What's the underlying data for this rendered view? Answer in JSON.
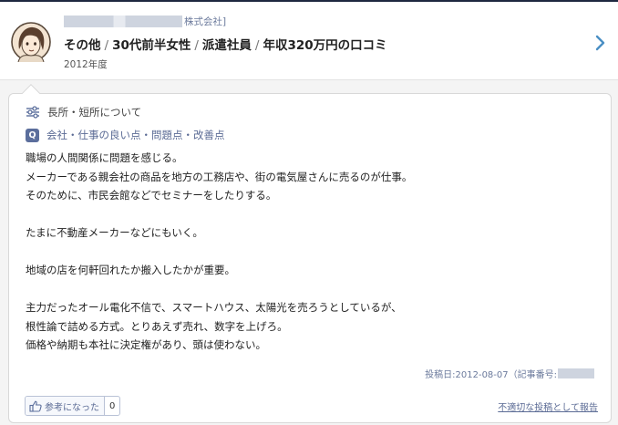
{
  "header": {
    "company_suffix": "株式会社]",
    "title_parts": [
      "その他",
      "30代前半女性",
      "派遣社員",
      "年収320万円の口コミ"
    ],
    "title_separator": "/",
    "year": "2012年度"
  },
  "review": {
    "category_label": "長所・短所について",
    "question_badge": "Q",
    "question_text": "会社・仕事の良い点・問題点・改善点",
    "paragraphs": [
      [
        "職場の人間関係に問題を感じる。",
        "メーカーである親会社の商品を地方の工務店や、街の電気屋さんに売るのが仕事。",
        "そのために、市民会館などでセミナーをしたりする。"
      ],
      [
        "たまに不動産メーカーなどにもいく。"
      ],
      [
        "地域の店を何軒回れたか搬入したかが重要。"
      ],
      [
        "主力だったオール電化不信で、スマートハウス、太陽光を売ろうとしているが、",
        "根性論で詰める方式。とりあえず売れ、数字を上げろ。",
        "価格や納期も本社に決定権があり、頭は使わない。"
      ]
    ],
    "post_meta": "投稿日:2012-08-07（記事番号:"
  },
  "footer": {
    "helpful_label": "参考になった",
    "helpful_count": "0",
    "report_label": "不適切な投稿として報告"
  },
  "colors": {
    "accent": "#5b6e9c",
    "header_border": "#1e2740",
    "chevron": "#4a8fc4"
  },
  "icons": [
    "avatar-female-icon",
    "chevron-right-icon",
    "sliders-icon",
    "thumbs-up-icon"
  ]
}
